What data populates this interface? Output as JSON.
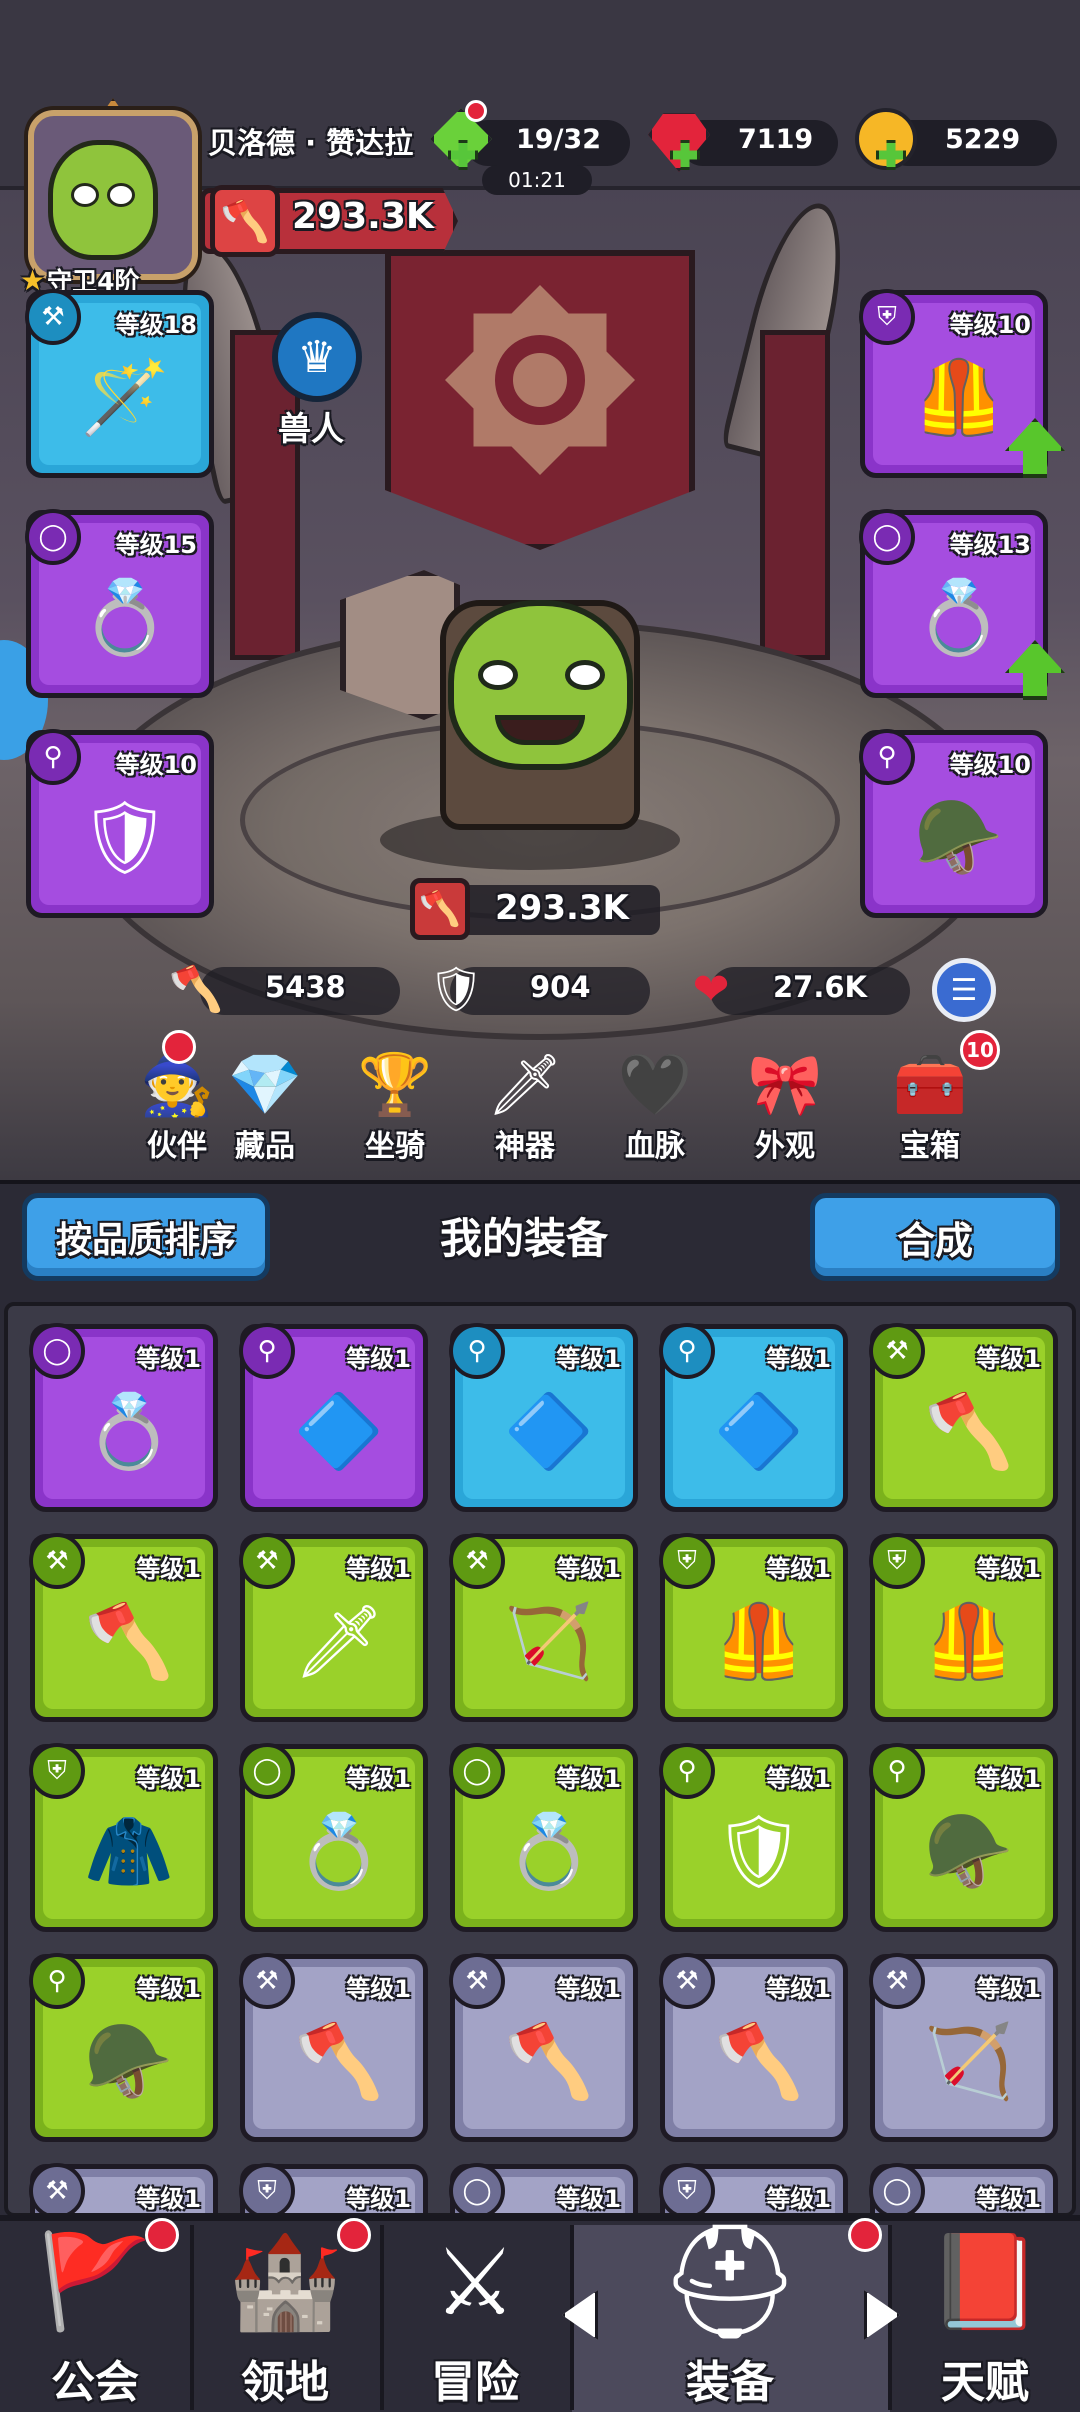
{
  "header": {
    "player_name": "贝洛德 · 赞达拉",
    "rank_label": "守卫4阶",
    "total_power": "293.3K",
    "energy": "19/32",
    "energy_timer": "01:21",
    "gems": "7119",
    "gold": "5229"
  },
  "race": {
    "label": "兽人",
    "icon": "orc-crest-icon"
  },
  "equipped": {
    "weapon": {
      "level": "等级18",
      "rarity": "blue",
      "icon": "staff-icon",
      "type_icon": "axe-type-icon"
    },
    "ring_left": {
      "level": "等级15",
      "rarity": "purple",
      "icon": "ring-icon",
      "type_icon": "ring-type-icon"
    },
    "amulet_left": {
      "level": "等级10",
      "rarity": "purple",
      "icon": "mask-icon",
      "type_icon": "amulet-type-icon"
    },
    "armor": {
      "level": "等级10",
      "rarity": "purple",
      "icon": "armor-icon",
      "type_icon": "armor-type-icon",
      "upgrade": true
    },
    "ring_right": {
      "level": "等级13",
      "rarity": "purple",
      "icon": "ring-icon",
      "type_icon": "ring-type-icon",
      "upgrade": true
    },
    "amulet_right": {
      "level": "等级10",
      "rarity": "purple",
      "icon": "helmet-icon",
      "type_icon": "amulet-type-icon"
    }
  },
  "hero": {
    "power": "293.3K"
  },
  "stats": {
    "attack": "5438",
    "defense": "904",
    "health": "27.6K"
  },
  "features": [
    {
      "label": "伙伴",
      "icon": "companion-icon",
      "dot": true
    },
    {
      "label": "藏品",
      "icon": "crystal-icon"
    },
    {
      "label": "坐骑",
      "icon": "mount-icon"
    },
    {
      "label": "神器",
      "icon": "artifact-sword-icon"
    },
    {
      "label": "血脉",
      "icon": "bloodline-icon"
    },
    {
      "label": "外观",
      "icon": "outfit-icon"
    },
    {
      "label": "宝箱",
      "icon": "chest-icon",
      "count": "10"
    }
  ],
  "inventory": {
    "sort_label": "按品质排序",
    "title": "我的装备",
    "merge_label": "合成",
    "items": [
      {
        "level": "等级1",
        "rarity": "purple",
        "icon": "ring-icon",
        "type": "ring"
      },
      {
        "level": "等级1",
        "rarity": "purple",
        "icon": "amulet-icon",
        "type": "amulet"
      },
      {
        "level": "等级1",
        "rarity": "blue",
        "icon": "amulet-icon",
        "type": "amulet"
      },
      {
        "level": "等级1",
        "rarity": "blue",
        "icon": "amulet-icon",
        "type": "amulet"
      },
      {
        "level": "等级1",
        "rarity": "green",
        "icon": "axe-icon",
        "type": "weapon"
      },
      {
        "level": "等级1",
        "rarity": "green",
        "icon": "axe-icon",
        "type": "weapon"
      },
      {
        "level": "等级1",
        "rarity": "green",
        "icon": "spear-icon",
        "type": "weapon"
      },
      {
        "level": "等级1",
        "rarity": "green",
        "icon": "bow-icon",
        "type": "weapon"
      },
      {
        "level": "等级1",
        "rarity": "green",
        "icon": "armor-icon",
        "type": "armor"
      },
      {
        "level": "等级1",
        "rarity": "green",
        "icon": "armor-icon",
        "type": "armor"
      },
      {
        "level": "等级1",
        "rarity": "green",
        "icon": "vest-icon",
        "type": "armor"
      },
      {
        "level": "等级1",
        "rarity": "green",
        "icon": "ring-icon",
        "type": "ring"
      },
      {
        "level": "等级1",
        "rarity": "green",
        "icon": "ring-icon",
        "type": "ring"
      },
      {
        "level": "等级1",
        "rarity": "green",
        "icon": "mask-icon",
        "type": "amulet"
      },
      {
        "level": "等级1",
        "rarity": "green",
        "icon": "helmet-icon",
        "type": "amulet"
      },
      {
        "level": "等级1",
        "rarity": "green",
        "icon": "helmet-icon",
        "type": "amulet"
      },
      {
        "level": "等级1",
        "rarity": "gray",
        "icon": "axe-icon",
        "type": "weapon"
      },
      {
        "level": "等级1",
        "rarity": "gray",
        "icon": "axe-icon",
        "type": "weapon"
      },
      {
        "level": "等级1",
        "rarity": "gray",
        "icon": "axe-icon",
        "type": "weapon"
      },
      {
        "level": "等级1",
        "rarity": "gray",
        "icon": "bow-icon",
        "type": "weapon"
      },
      {
        "level": "等级1",
        "rarity": "gray",
        "icon": "axe-icon",
        "type": "weapon"
      },
      {
        "level": "等级1",
        "rarity": "gray",
        "icon": "armor-icon",
        "type": "armor"
      },
      {
        "level": "等级1",
        "rarity": "gray",
        "icon": "ring-icon",
        "type": "ring"
      },
      {
        "level": "等级1",
        "rarity": "gray",
        "icon": "armor-icon",
        "type": "armor"
      },
      {
        "level": "等级1",
        "rarity": "gray",
        "icon": "ring-icon",
        "type": "ring"
      }
    ]
  },
  "nav": [
    {
      "label": "公会",
      "icon": "guild-banner-icon",
      "dot": true
    },
    {
      "label": "领地",
      "icon": "castle-icon",
      "dot": true
    },
    {
      "label": "冒险",
      "icon": "crossed-axes-icon"
    },
    {
      "label": "装备",
      "icon": "helmet-icon",
      "dot": true,
      "active": true
    },
    {
      "label": "天赋",
      "icon": "talent-book-icon"
    }
  ],
  "colors": {
    "purple": "#a54de0",
    "blue": "#3dbce9",
    "green": "#9ad12a",
    "gray": "#a3a3c6",
    "accent_button": "#3ea0e8",
    "notification": "#e3243b"
  }
}
